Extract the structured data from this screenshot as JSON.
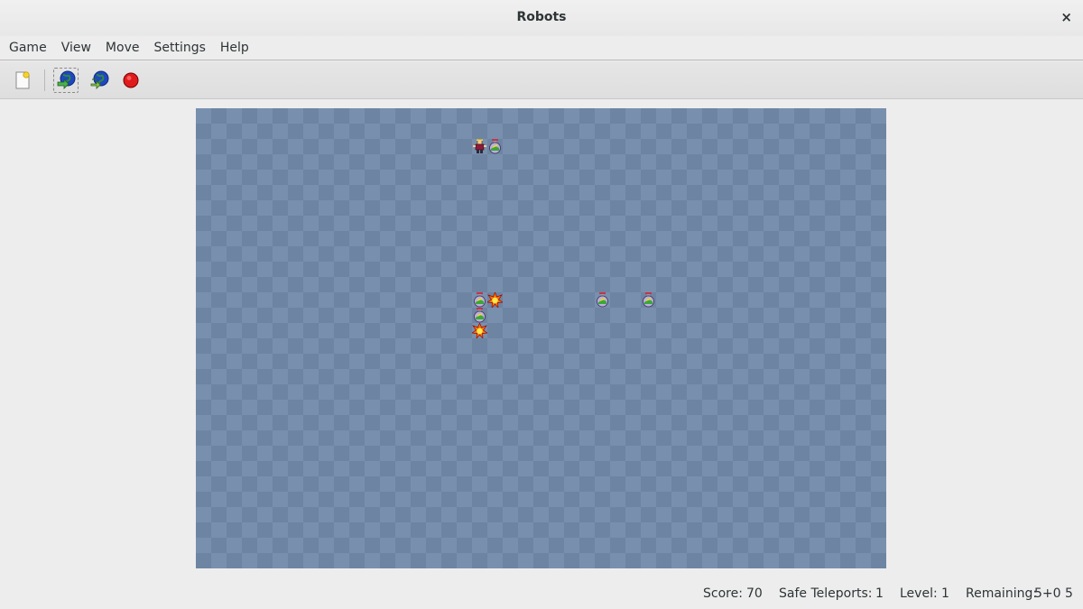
{
  "window": {
    "title": "Robots",
    "close_glyph": "×"
  },
  "menu": [
    "Game",
    "View",
    "Move",
    "Settings",
    "Help"
  ],
  "toolbar": [
    {
      "name": "new-game-button",
      "icon": "new-document-icon"
    },
    {
      "name": "teleport-button",
      "icon": "teleport-globe-icon"
    },
    {
      "name": "random-teleport-button",
      "icon": "random-teleport-globe-icon"
    },
    {
      "name": "wait-button",
      "icon": "stop-icon"
    }
  ],
  "board": {
    "columns": 45,
    "rows": 30,
    "pieces": [
      {
        "type": "player",
        "col": 18,
        "row": 2
      },
      {
        "type": "robot",
        "col": 19,
        "row": 2
      },
      {
        "type": "robot",
        "col": 18,
        "row": 12
      },
      {
        "type": "junk",
        "col": 19,
        "row": 12
      },
      {
        "type": "robot",
        "col": 26,
        "row": 12
      },
      {
        "type": "robot",
        "col": 29,
        "row": 12
      },
      {
        "type": "robot",
        "col": 18,
        "row": 13
      },
      {
        "type": "junk",
        "col": 18,
        "row": 14
      }
    ]
  },
  "status": {
    "score_label": "Score:",
    "score": "70",
    "teleports_label": "Safe Teleports:",
    "teleports": "1",
    "level_label": "Level:",
    "level": "1",
    "remaining_label": "Remaining:",
    "remaining": "5+0 5"
  }
}
